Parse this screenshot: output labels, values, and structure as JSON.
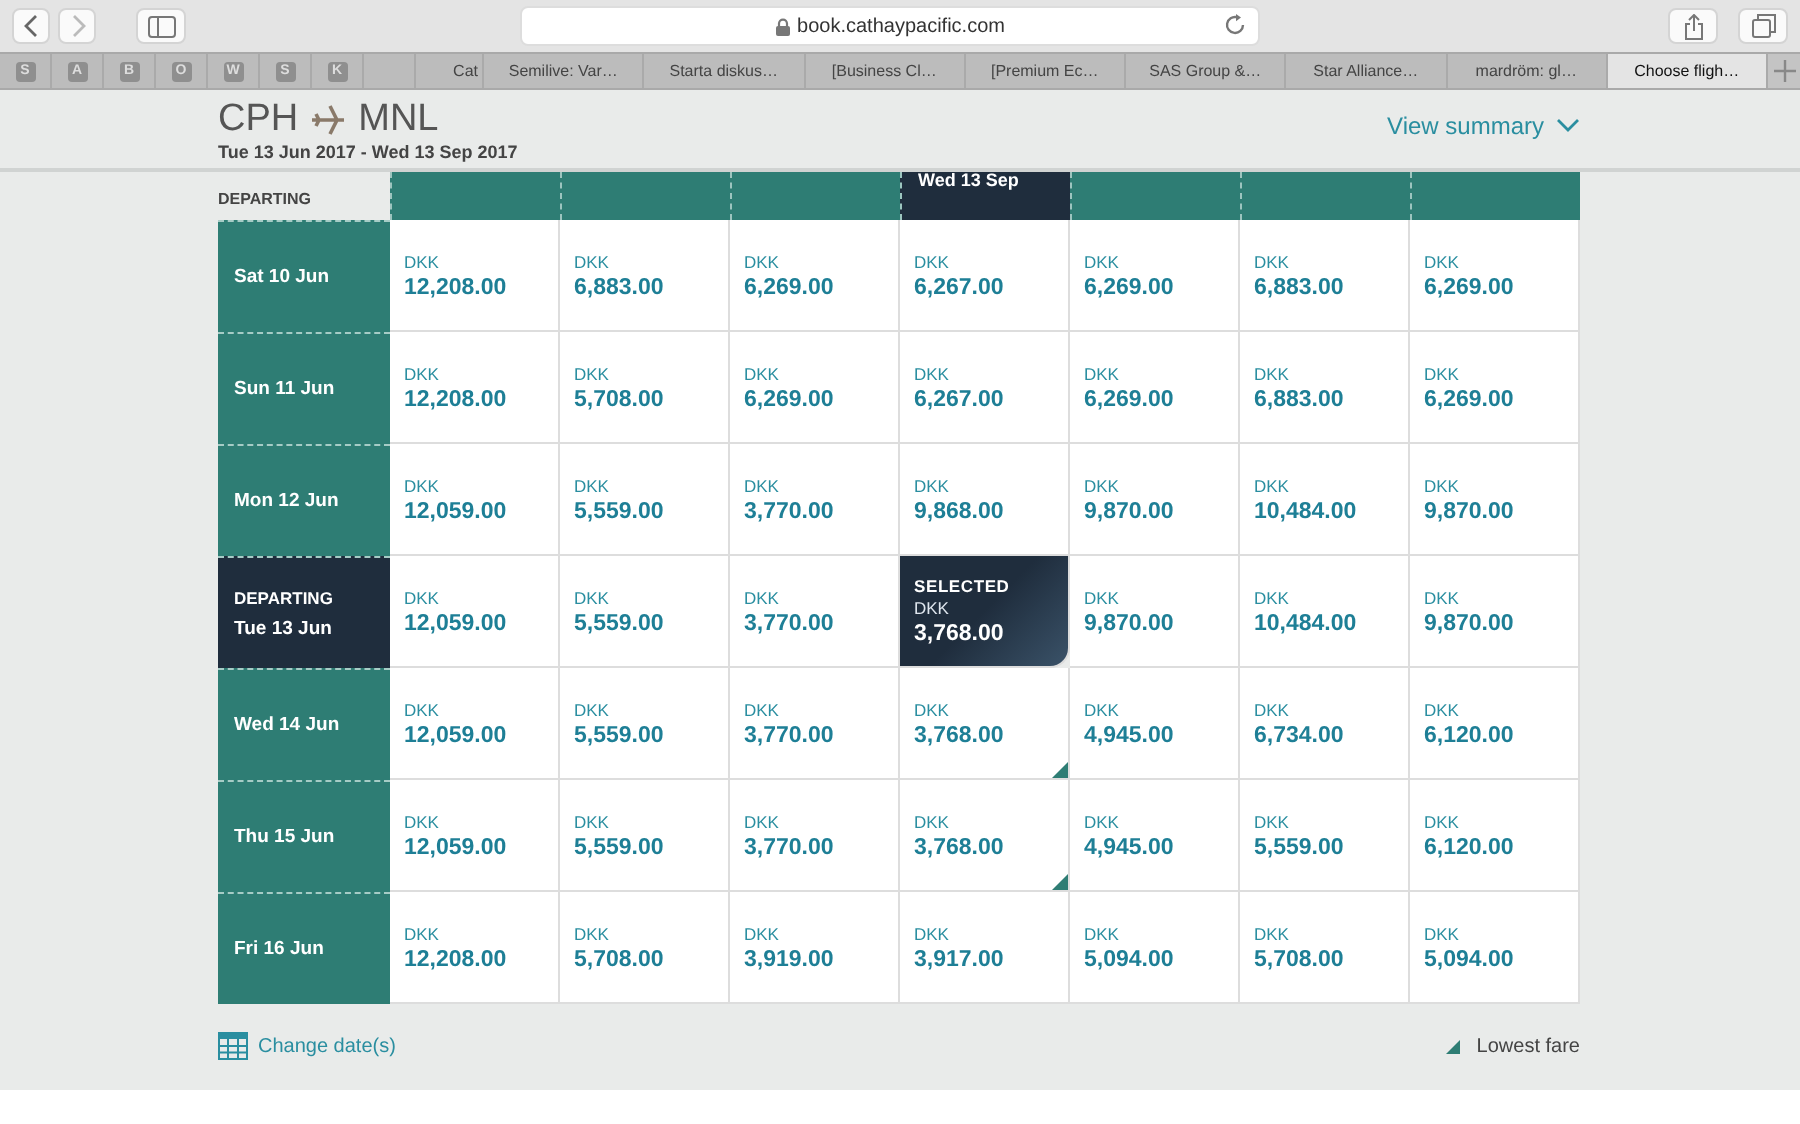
{
  "browser": {
    "url": "book.cathaypacific.com",
    "favorites": [
      "S",
      "A",
      "B",
      "O",
      "W",
      "S",
      "K"
    ],
    "tabs": [
      {
        "title": "Cat",
        "selected": false
      },
      {
        "title": "Semilive: Var…",
        "selected": false
      },
      {
        "title": "Starta diskus…",
        "selected": false
      },
      {
        "title": "[Business Cl…",
        "selected": false
      },
      {
        "title": "[Premium Ec…",
        "selected": false
      },
      {
        "title": "SAS Group &…",
        "selected": false
      },
      {
        "title": "Star Alliance…",
        "selected": false
      },
      {
        "title": "mardröm: gl…",
        "selected": false
      },
      {
        "title": "Choose fligh…",
        "selected": true
      }
    ]
  },
  "header": {
    "origin": "CPH",
    "destination": "MNL",
    "dates": "Tue 13 Jun 2017 - Wed 13 Sep 2017",
    "summary_link": "View summary"
  },
  "grid": {
    "row_heading": "DEPARTING",
    "return_columns": [
      {
        "selected": false
      },
      {
        "selected": false
      },
      {
        "selected": false
      },
      {
        "label": "Wed 13 Sep",
        "selected": true
      },
      {
        "selected": false
      },
      {
        "selected": false
      },
      {
        "selected": false
      }
    ],
    "rows": [
      {
        "date": "Sat 10 Jun",
        "selected": false,
        "cells": [
          {
            "currency": "DKK",
            "price": "12,208.00",
            "selected": false,
            "lowest": false
          },
          {
            "currency": "DKK",
            "price": "6,883.00",
            "selected": false,
            "lowest": false
          },
          {
            "currency": "DKK",
            "price": "6,269.00",
            "selected": false,
            "lowest": false
          },
          {
            "currency": "DKK",
            "price": "6,267.00",
            "selected": false,
            "lowest": false
          },
          {
            "currency": "DKK",
            "price": "6,269.00",
            "selected": false,
            "lowest": false
          },
          {
            "currency": "DKK",
            "price": "6,883.00",
            "selected": false,
            "lowest": false
          },
          {
            "currency": "DKK",
            "price": "6,269.00",
            "selected": false,
            "lowest": false
          }
        ]
      },
      {
        "date": "Sun 11 Jun",
        "selected": false,
        "cells": [
          {
            "currency": "DKK",
            "price": "12,208.00",
            "selected": false,
            "lowest": false
          },
          {
            "currency": "DKK",
            "price": "5,708.00",
            "selected": false,
            "lowest": false
          },
          {
            "currency": "DKK",
            "price": "6,269.00",
            "selected": false,
            "lowest": false
          },
          {
            "currency": "DKK",
            "price": "6,267.00",
            "selected": false,
            "lowest": false
          },
          {
            "currency": "DKK",
            "price": "6,269.00",
            "selected": false,
            "lowest": false
          },
          {
            "currency": "DKK",
            "price": "6,883.00",
            "selected": false,
            "lowest": false
          },
          {
            "currency": "DKK",
            "price": "6,269.00",
            "selected": false,
            "lowest": false
          }
        ]
      },
      {
        "date": "Mon 12 Jun",
        "selected": false,
        "cells": [
          {
            "currency": "DKK",
            "price": "12,059.00",
            "selected": false,
            "lowest": false
          },
          {
            "currency": "DKK",
            "price": "5,559.00",
            "selected": false,
            "lowest": false
          },
          {
            "currency": "DKK",
            "price": "3,770.00",
            "selected": false,
            "lowest": false
          },
          {
            "currency": "DKK",
            "price": "9,868.00",
            "selected": false,
            "lowest": false
          },
          {
            "currency": "DKK",
            "price": "9,870.00",
            "selected": false,
            "lowest": false
          },
          {
            "currency": "DKK",
            "price": "10,484.00",
            "selected": false,
            "lowest": false
          },
          {
            "currency": "DKK",
            "price": "9,870.00",
            "selected": false,
            "lowest": false
          }
        ]
      },
      {
        "label": "DEPARTING",
        "date": "Tue 13 Jun",
        "selected": true,
        "cells": [
          {
            "currency": "DKK",
            "price": "12,059.00",
            "selected": false,
            "lowest": false
          },
          {
            "currency": "DKK",
            "price": "5,559.00",
            "selected": false,
            "lowest": false
          },
          {
            "currency": "DKK",
            "price": "3,770.00",
            "selected": false,
            "lowest": false
          },
          {
            "badge": "SELECTED",
            "currency": "DKK",
            "price": "3,768.00",
            "selected": true,
            "lowest": false
          },
          {
            "currency": "DKK",
            "price": "9,870.00",
            "selected": false,
            "lowest": false
          },
          {
            "currency": "DKK",
            "price": "10,484.00",
            "selected": false,
            "lowest": false
          },
          {
            "currency": "DKK",
            "price": "9,870.00",
            "selected": false,
            "lowest": false
          }
        ]
      },
      {
        "date": "Wed 14 Jun",
        "selected": false,
        "cells": [
          {
            "currency": "DKK",
            "price": "12,059.00",
            "selected": false,
            "lowest": false
          },
          {
            "currency": "DKK",
            "price": "5,559.00",
            "selected": false,
            "lowest": false
          },
          {
            "currency": "DKK",
            "price": "3,770.00",
            "selected": false,
            "lowest": false
          },
          {
            "currency": "DKK",
            "price": "3,768.00",
            "selected": false,
            "lowest": true
          },
          {
            "currency": "DKK",
            "price": "4,945.00",
            "selected": false,
            "lowest": false
          },
          {
            "currency": "DKK",
            "price": "6,734.00",
            "selected": false,
            "lowest": false
          },
          {
            "currency": "DKK",
            "price": "6,120.00",
            "selected": false,
            "lowest": false
          }
        ]
      },
      {
        "date": "Thu 15 Jun",
        "selected": false,
        "cells": [
          {
            "currency": "DKK",
            "price": "12,059.00",
            "selected": false,
            "lowest": false
          },
          {
            "currency": "DKK",
            "price": "5,559.00",
            "selected": false,
            "lowest": false
          },
          {
            "currency": "DKK",
            "price": "3,770.00",
            "selected": false,
            "lowest": false
          },
          {
            "currency": "DKK",
            "price": "3,768.00",
            "selected": false,
            "lowest": true
          },
          {
            "currency": "DKK",
            "price": "4,945.00",
            "selected": false,
            "lowest": false
          },
          {
            "currency": "DKK",
            "price": "5,559.00",
            "selected": false,
            "lowest": false
          },
          {
            "currency": "DKK",
            "price": "6,120.00",
            "selected": false,
            "lowest": false
          }
        ]
      },
      {
        "date": "Fri 16 Jun",
        "selected": false,
        "cells": [
          {
            "currency": "DKK",
            "price": "12,208.00",
            "selected": false,
            "lowest": false
          },
          {
            "currency": "DKK",
            "price": "5,708.00",
            "selected": false,
            "lowest": false
          },
          {
            "currency": "DKK",
            "price": "3,919.00",
            "selected": false,
            "lowest": false
          },
          {
            "currency": "DKK",
            "price": "3,917.00",
            "selected": false,
            "lowest": false
          },
          {
            "currency": "DKK",
            "price": "5,094.00",
            "selected": false,
            "lowest": false
          },
          {
            "currency": "DKK",
            "price": "5,708.00",
            "selected": false,
            "lowest": false
          },
          {
            "currency": "DKK",
            "price": "5,094.00",
            "selected": false,
            "lowest": false
          }
        ]
      }
    ]
  },
  "footer": {
    "change_dates": "Change date(s)",
    "legend": "Lowest fare"
  }
}
